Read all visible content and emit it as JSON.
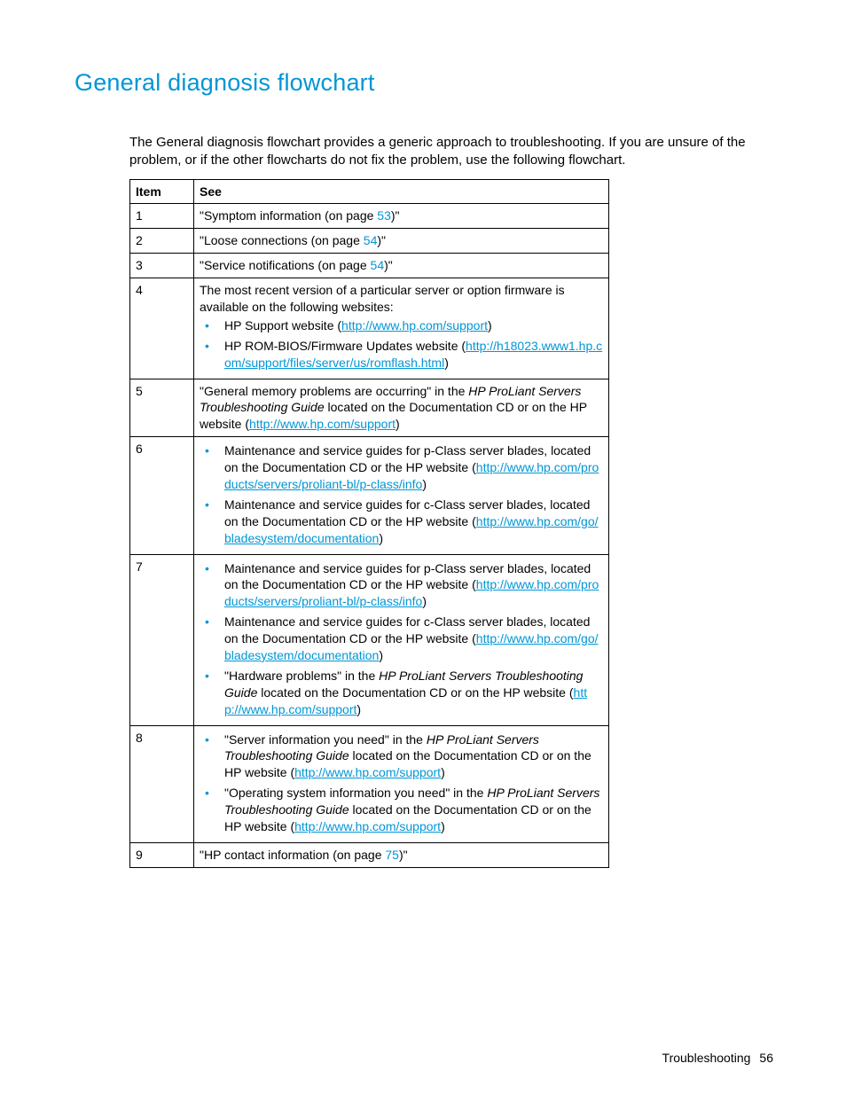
{
  "title": "General diagnosis flowchart",
  "intro": "The General diagnosis flowchart provides a generic approach to troubleshooting. If you are unsure of the problem, or if the other flowcharts do not fix the problem, use the following flowchart.",
  "headers": {
    "item": "Item",
    "see": "See"
  },
  "pub": "HP ProLiant Servers Troubleshooting Guide",
  "rows": {
    "r1": {
      "item": "1",
      "text_a": "\"Symptom information (on page ",
      "page": "53",
      "text_b": ")\""
    },
    "r2": {
      "item": "2",
      "text_a": "\"Loose connections (on page ",
      "page": "54",
      "text_b": ")\""
    },
    "r3": {
      "item": "3",
      "text_a": "\"Service notifications (on page ",
      "page": "54",
      "text_b": ")\""
    },
    "r4": {
      "item": "4",
      "lead": "The most recent version of a particular server or option firmware is available on the following websites:",
      "b1_a": "HP Support website (",
      "b1_url": "http://www.hp.com/support",
      "b1_b": ")",
      "b2_a": "HP ROM-BIOS/Firmware Updates website (",
      "b2_url": "http://h18023.www1.hp.com/support/files/server/us/romflash.html",
      "b2_b": ")"
    },
    "r5": {
      "item": "5",
      "a": "\"General memory problems are occurring\" in the ",
      "b": " located on the Documentation CD or on the HP website (",
      "url": "http://www.hp.com/support",
      "c": ")"
    },
    "r6": {
      "item": "6",
      "b1_a": "Maintenance and service guides for p-Class server blades, located on the Documentation CD or the HP website (",
      "b1_url": "http://www.hp.com/products/servers/proliant-bl/p-class/info",
      "b1_b": ")",
      "b2_a": "Maintenance and service guides for c-Class server blades, located on the Documentation CD or the HP website (",
      "b2_url": "http://www.hp.com/go/bladesystem/documentation",
      "b2_b": ")"
    },
    "r7": {
      "item": "7",
      "b1_a": "Maintenance and service guides for p-Class server blades, located on the Documentation CD or the HP website (",
      "b1_url": "http://www.hp.com/products/servers/proliant-bl/p-class/info",
      "b1_b": ")",
      "b2_a": "Maintenance and service guides for c-Class server blades, located on the Documentation CD or the HP website (",
      "b2_url": "http://www.hp.com/go/bladesystem/documentation",
      "b2_b": ")",
      "b3_a": "\"Hardware problems\" in the ",
      "b3_b": " located on the Documentation CD or on the HP website (",
      "b3_url": "http://www.hp.com/support",
      "b3_c": ")"
    },
    "r8": {
      "item": "8",
      "b1_a": "\"Server information you need\" in the ",
      "b1_b": " located on the Documentation CD or on the HP website (",
      "b1_url": "http://www.hp.com/support",
      "b1_c": ")",
      "b2_a": "\"Operating system information you need\" in the ",
      "b2_b": " located on the Documentation CD or on the HP website (",
      "b2_url": "http://www.hp.com/support",
      "b2_c": ")"
    },
    "r9": {
      "item": "9",
      "text_a": "\"HP contact information (on page ",
      "page": "75",
      "text_b": ")\""
    }
  },
  "footer": {
    "section": "Troubleshooting",
    "page": "56"
  }
}
